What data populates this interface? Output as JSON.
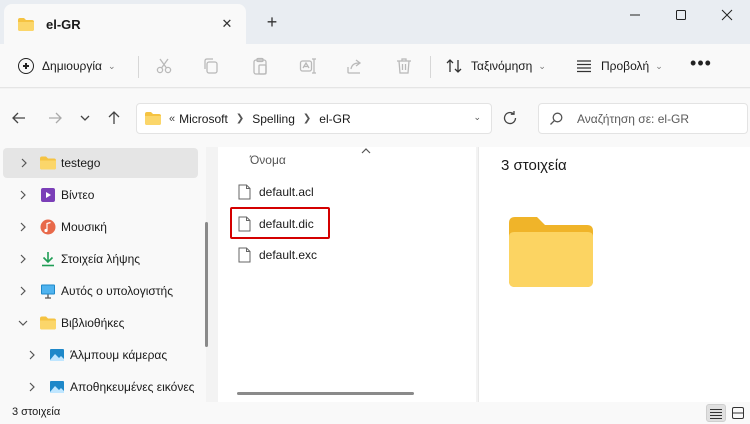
{
  "window": {
    "tab_title": "el-GR",
    "icons": {
      "close": "close-icon",
      "new_tab": "plus-icon",
      "minimize": "minimize-icon",
      "maximize": "maximize-icon",
      "window_close": "close-icon"
    }
  },
  "toolbar": {
    "new_label": "Δημιουργία",
    "sort_label": "Ταξινόμηση",
    "view_label": "Προβολή",
    "more_label": "•••",
    "icons": [
      "cut-icon",
      "copy-icon",
      "paste-icon",
      "rename-icon",
      "share-icon",
      "delete-icon",
      "sort-icon",
      "view-icon",
      "more-icon"
    ]
  },
  "address": {
    "lead": "«",
    "crumbs": [
      "Microsoft",
      "Spelling",
      "el-GR"
    ]
  },
  "search": {
    "placeholder": "Αναζήτηση σε: el-GR"
  },
  "sidebar": {
    "items": [
      {
        "label": "testego",
        "icon": "folder-icon",
        "selected": true
      },
      {
        "label": "Βίντεο",
        "icon": "video-icon"
      },
      {
        "label": "Μουσική",
        "icon": "music-icon"
      },
      {
        "label": "Στοιχεία λήψης",
        "icon": "download-icon"
      },
      {
        "label": "Αυτός ο υπολογιστής",
        "icon": "computer-icon"
      },
      {
        "label": "Βιβλιοθήκες",
        "icon": "folder-icon",
        "expanded": true
      },
      {
        "label": "Άλμπουμ κάμερας",
        "icon": "picture-icon"
      },
      {
        "label": "Αποθηκευμένες εικόνες",
        "icon": "picture-icon"
      }
    ]
  },
  "filelist": {
    "column_header": "Όνομα",
    "files": [
      {
        "name": "default.acl",
        "icon": "file-icon"
      },
      {
        "name": "default.dic",
        "icon": "file-icon",
        "highlighted": true
      },
      {
        "name": "default.exc",
        "icon": "file-icon"
      }
    ]
  },
  "details": {
    "count_label": "3 στοιχεία",
    "icon": "folder-icon"
  },
  "status": {
    "count_label": "3 στοιχεία"
  },
  "colors": {
    "highlight": "#d40000",
    "folder": "#f5c342",
    "accent": "#0067c0"
  }
}
